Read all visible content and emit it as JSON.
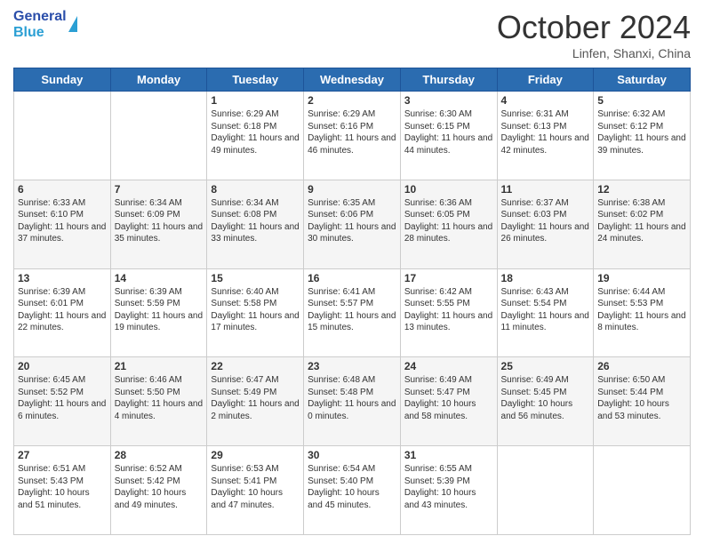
{
  "header": {
    "logo_general": "General",
    "logo_blue": "Blue",
    "month_title": "October 2024",
    "subtitle": "Linfen, Shanxi, China"
  },
  "days_of_week": [
    "Sunday",
    "Monday",
    "Tuesday",
    "Wednesday",
    "Thursday",
    "Friday",
    "Saturday"
  ],
  "weeks": [
    [
      {
        "day": "",
        "info": ""
      },
      {
        "day": "",
        "info": ""
      },
      {
        "day": "1",
        "info": "Sunrise: 6:29 AM\nSunset: 6:18 PM\nDaylight: 11 hours and 49 minutes."
      },
      {
        "day": "2",
        "info": "Sunrise: 6:29 AM\nSunset: 6:16 PM\nDaylight: 11 hours and 46 minutes."
      },
      {
        "day": "3",
        "info": "Sunrise: 6:30 AM\nSunset: 6:15 PM\nDaylight: 11 hours and 44 minutes."
      },
      {
        "day": "4",
        "info": "Sunrise: 6:31 AM\nSunset: 6:13 PM\nDaylight: 11 hours and 42 minutes."
      },
      {
        "day": "5",
        "info": "Sunrise: 6:32 AM\nSunset: 6:12 PM\nDaylight: 11 hours and 39 minutes."
      }
    ],
    [
      {
        "day": "6",
        "info": "Sunrise: 6:33 AM\nSunset: 6:10 PM\nDaylight: 11 hours and 37 minutes."
      },
      {
        "day": "7",
        "info": "Sunrise: 6:34 AM\nSunset: 6:09 PM\nDaylight: 11 hours and 35 minutes."
      },
      {
        "day": "8",
        "info": "Sunrise: 6:34 AM\nSunset: 6:08 PM\nDaylight: 11 hours and 33 minutes."
      },
      {
        "day": "9",
        "info": "Sunrise: 6:35 AM\nSunset: 6:06 PM\nDaylight: 11 hours and 30 minutes."
      },
      {
        "day": "10",
        "info": "Sunrise: 6:36 AM\nSunset: 6:05 PM\nDaylight: 11 hours and 28 minutes."
      },
      {
        "day": "11",
        "info": "Sunrise: 6:37 AM\nSunset: 6:03 PM\nDaylight: 11 hours and 26 minutes."
      },
      {
        "day": "12",
        "info": "Sunrise: 6:38 AM\nSunset: 6:02 PM\nDaylight: 11 hours and 24 minutes."
      }
    ],
    [
      {
        "day": "13",
        "info": "Sunrise: 6:39 AM\nSunset: 6:01 PM\nDaylight: 11 hours and 22 minutes."
      },
      {
        "day": "14",
        "info": "Sunrise: 6:39 AM\nSunset: 5:59 PM\nDaylight: 11 hours and 19 minutes."
      },
      {
        "day": "15",
        "info": "Sunrise: 6:40 AM\nSunset: 5:58 PM\nDaylight: 11 hours and 17 minutes."
      },
      {
        "day": "16",
        "info": "Sunrise: 6:41 AM\nSunset: 5:57 PM\nDaylight: 11 hours and 15 minutes."
      },
      {
        "day": "17",
        "info": "Sunrise: 6:42 AM\nSunset: 5:55 PM\nDaylight: 11 hours and 13 minutes."
      },
      {
        "day": "18",
        "info": "Sunrise: 6:43 AM\nSunset: 5:54 PM\nDaylight: 11 hours and 11 minutes."
      },
      {
        "day": "19",
        "info": "Sunrise: 6:44 AM\nSunset: 5:53 PM\nDaylight: 11 hours and 8 minutes."
      }
    ],
    [
      {
        "day": "20",
        "info": "Sunrise: 6:45 AM\nSunset: 5:52 PM\nDaylight: 11 hours and 6 minutes."
      },
      {
        "day": "21",
        "info": "Sunrise: 6:46 AM\nSunset: 5:50 PM\nDaylight: 11 hours and 4 minutes."
      },
      {
        "day": "22",
        "info": "Sunrise: 6:47 AM\nSunset: 5:49 PM\nDaylight: 11 hours and 2 minutes."
      },
      {
        "day": "23",
        "info": "Sunrise: 6:48 AM\nSunset: 5:48 PM\nDaylight: 11 hours and 0 minutes."
      },
      {
        "day": "24",
        "info": "Sunrise: 6:49 AM\nSunset: 5:47 PM\nDaylight: 10 hours and 58 minutes."
      },
      {
        "day": "25",
        "info": "Sunrise: 6:49 AM\nSunset: 5:45 PM\nDaylight: 10 hours and 56 minutes."
      },
      {
        "day": "26",
        "info": "Sunrise: 6:50 AM\nSunset: 5:44 PM\nDaylight: 10 hours and 53 minutes."
      }
    ],
    [
      {
        "day": "27",
        "info": "Sunrise: 6:51 AM\nSunset: 5:43 PM\nDaylight: 10 hours and 51 minutes."
      },
      {
        "day": "28",
        "info": "Sunrise: 6:52 AM\nSunset: 5:42 PM\nDaylight: 10 hours and 49 minutes."
      },
      {
        "day": "29",
        "info": "Sunrise: 6:53 AM\nSunset: 5:41 PM\nDaylight: 10 hours and 47 minutes."
      },
      {
        "day": "30",
        "info": "Sunrise: 6:54 AM\nSunset: 5:40 PM\nDaylight: 10 hours and 45 minutes."
      },
      {
        "day": "31",
        "info": "Sunrise: 6:55 AM\nSunset: 5:39 PM\nDaylight: 10 hours and 43 minutes."
      },
      {
        "day": "",
        "info": ""
      },
      {
        "day": "",
        "info": ""
      }
    ]
  ]
}
